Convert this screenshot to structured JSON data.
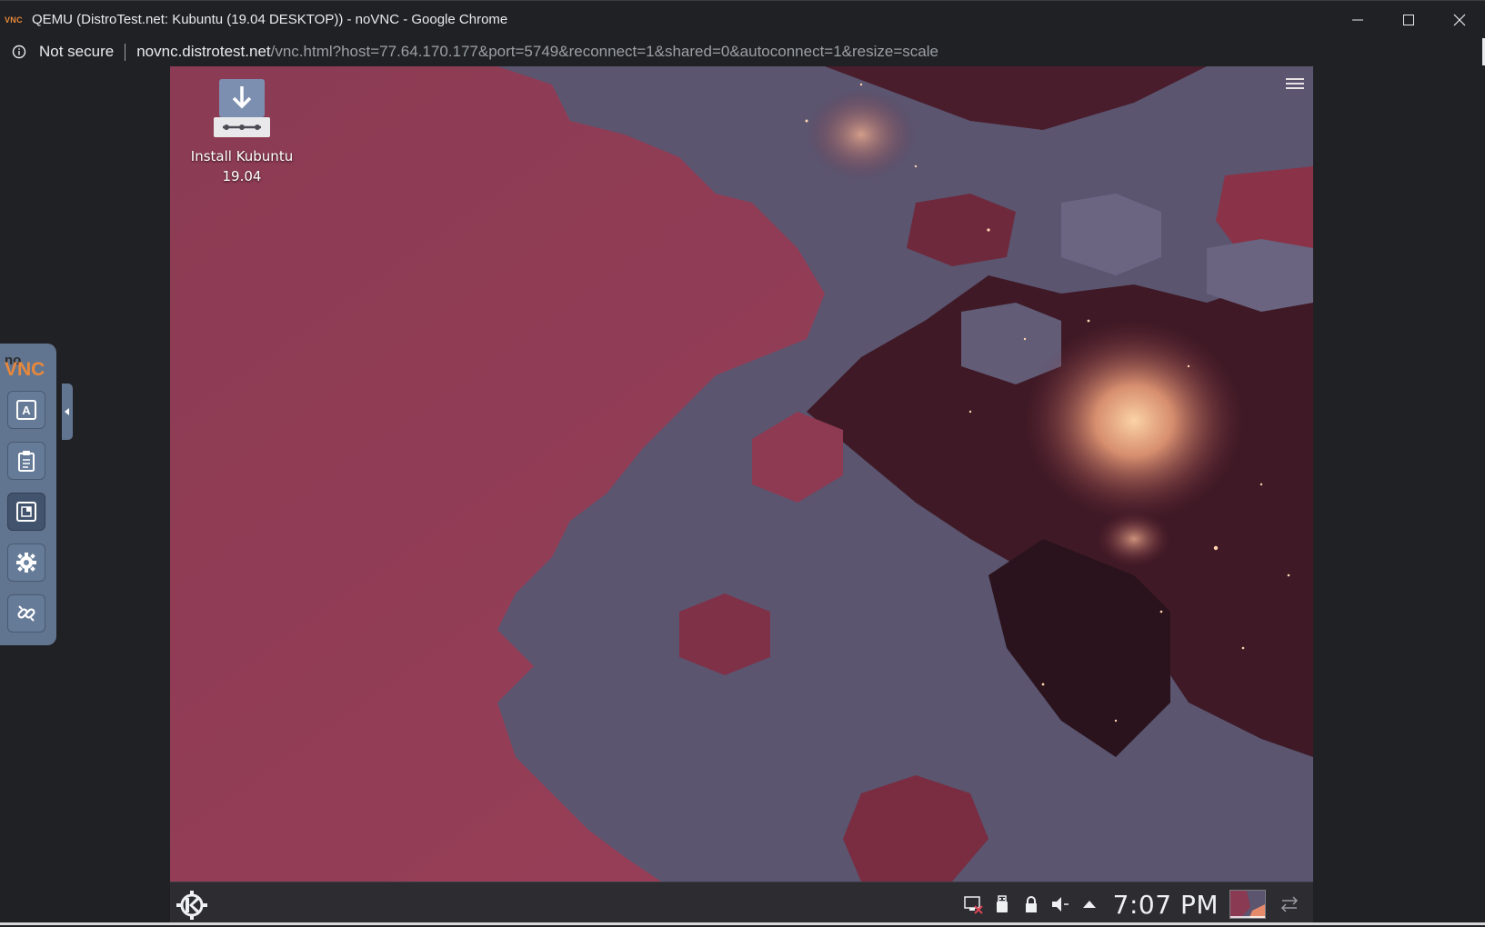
{
  "window": {
    "favicon_text": "VNC",
    "title": "QEMU (DistroTest.net: Kubuntu (19.04 DESKTOP)) - noVNC - Google Chrome",
    "minimize_icon": "minimize-icon",
    "maximize_icon": "maximize-icon",
    "close_icon": "close-icon"
  },
  "address_bar": {
    "security_label": "Not secure",
    "url_host": "novnc.distrotest.net",
    "url_path": "/vnc.html?host=77.64.170.177&port=5749&reconnect=1&shared=0&autoconnect=1&resize=scale"
  },
  "desktop": {
    "icons": [
      {
        "label_line1": "Install Kubuntu",
        "label_line2": "19.04",
        "icon": "install-download-icon"
      }
    ],
    "toolbox_icon": "hamburger-menu-icon",
    "colors": {
      "wallpaper_primary": "#8a3a52",
      "wallpaper_slate": "#5c5670",
      "nebula_glow": "#f2b080"
    }
  },
  "panel": {
    "launcher_icon": "kde-logo-icon",
    "tray_icons": [
      "network-disconnected-icon",
      "usb-device-icon",
      "lock-icon",
      "volume-icon",
      "expand-arrow-icon"
    ],
    "clock": "7:07 PM",
    "pager_icon": "desktop-pager-icon",
    "panel_options_icon": "panel-settings-icon"
  },
  "novnc": {
    "logo_no": "no",
    "logo_vnc": "VNC",
    "buttons": [
      {
        "name": "extra-keys",
        "icon": "keyboard-keys-icon"
      },
      {
        "name": "clipboard",
        "icon": "clipboard-icon"
      },
      {
        "name": "fullscreen",
        "icon": "fullscreen-icon",
        "selected": true
      },
      {
        "name": "settings",
        "icon": "gear-icon"
      },
      {
        "name": "disconnect",
        "icon": "disconnect-icon"
      }
    ],
    "accent_color": "#e8883a"
  }
}
